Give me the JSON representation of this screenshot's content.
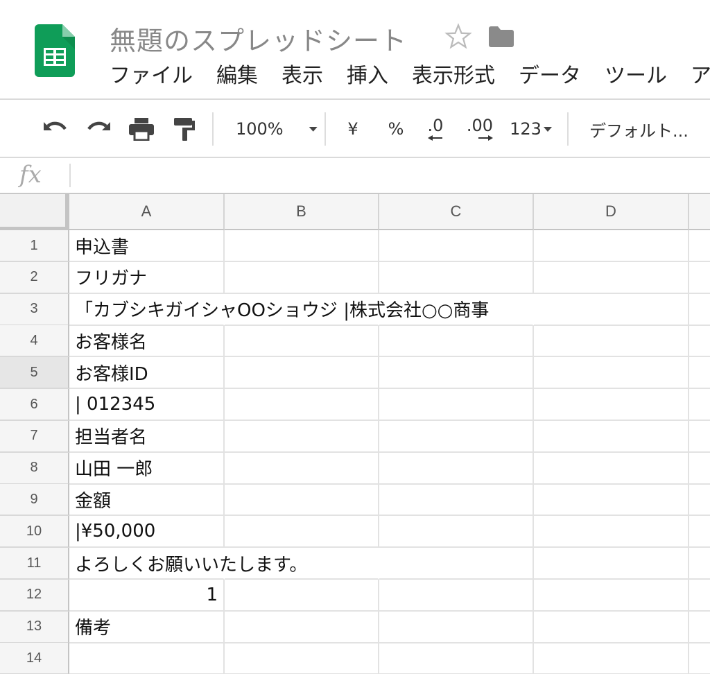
{
  "app": {
    "title": "無題のスプレッドシート",
    "menu": [
      "ファイル",
      "編集",
      "表示",
      "挿入",
      "表示形式",
      "データ",
      "ツール",
      "ア"
    ]
  },
  "toolbar": {
    "zoom": "100%",
    "currency": "¥",
    "percent": "%",
    "decimal_decrease": ".0",
    "decimal_increase": ".00",
    "format_more": "123",
    "font": "デフォルト..."
  },
  "formula_bar": {
    "label": "fx",
    "value": ""
  },
  "columns": [
    "A",
    "B",
    "C",
    "D"
  ],
  "rows": [
    {
      "num": "1",
      "a": "申込書"
    },
    {
      "num": "2",
      "a": "フリガナ"
    },
    {
      "num": "3",
      "a": "「カブシキガイシャOOショウジ |株式会社○○商事"
    },
    {
      "num": "4",
      "a": "お客様名"
    },
    {
      "num": "5",
      "a": "お客様ID"
    },
    {
      "num": "6",
      "a": "| 012345"
    },
    {
      "num": "7",
      "a": "担当者名"
    },
    {
      "num": "8",
      "a": "山田 一郎"
    },
    {
      "num": "9",
      "a": "金額"
    },
    {
      "num": "10",
      "a": "|¥50,000"
    },
    {
      "num": "11",
      "a": "よろしくお願いいたします。"
    },
    {
      "num": "12",
      "a": "1"
    },
    {
      "num": "13",
      "a": "備考"
    },
    {
      "num": "14",
      "a": ""
    }
  ],
  "colors": {
    "sheets_green": "#0f9d58",
    "sheets_green_dark": "#0b8043",
    "header_bg": "#f5f5f5",
    "grid_line": "#e2e2e2"
  }
}
